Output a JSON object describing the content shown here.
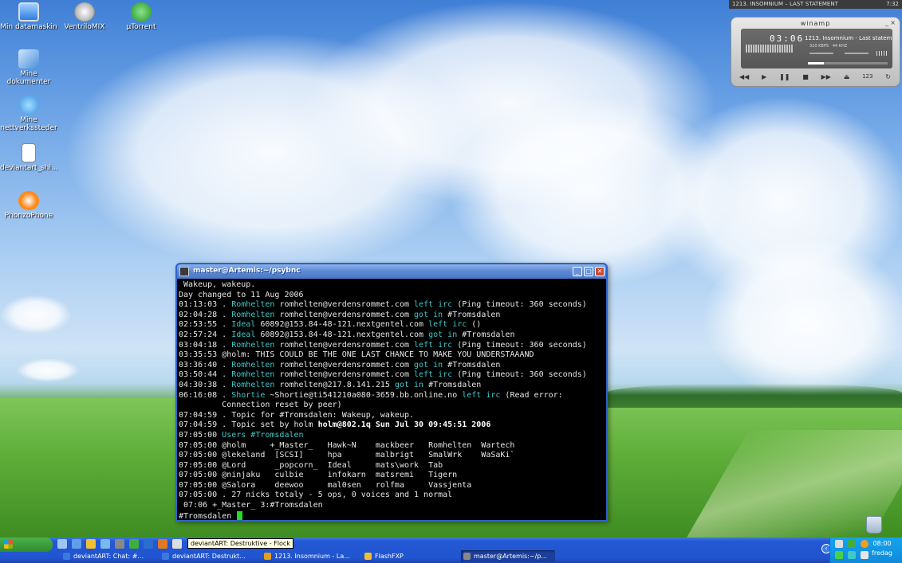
{
  "desktop": {
    "icons": [
      {
        "label": "Min datamaskin",
        "icon": "computer-icon",
        "color": "#2f7de0"
      },
      {
        "label": "VentriloMIX",
        "icon": "ventrilo-icon",
        "color": "#e6e6e6"
      },
      {
        "label": "µTorrent",
        "icon": "utorrent-icon",
        "color": "#3fae3f"
      },
      {
        "label": "Mine dokumenter",
        "icon": "documents-folder-icon",
        "color": "#4a90d9"
      },
      {
        "label": "Mine nettverkssteder",
        "icon": "network-places-icon",
        "color": "#3b8de0"
      },
      {
        "label": "deviantart_shi...",
        "icon": "text-file-icon",
        "color": "#ffffff"
      },
      {
        "label": "PhonzoPhone",
        "icon": "phone-app-icon",
        "color": "#ff8a1c"
      }
    ]
  },
  "winamp": {
    "topbar_title": "1213. INSOMNIUM – LAST STATEMENT",
    "topbar_time": "7:32",
    "title": "winamp",
    "time": "03:06",
    "song": "1213. Insomnium - Last statem",
    "kbps": "320",
    "kbps_unit": "KBPS",
    "khz": "44",
    "khz_unit": "KHZ",
    "track_number": "123"
  },
  "terminal": {
    "title": "master@Artemis:~/psybnc",
    "lines": [
      [
        {
          "t": " Wakeup, wakeup."
        }
      ],
      [
        {
          "t": "Day changed to 11 Aug 2006"
        }
      ],
      [
        {
          "t": "01:13:03 . "
        },
        {
          "t": "Romhelten",
          "c": "c"
        },
        {
          "t": " romhelten@verdensrommet.com "
        },
        {
          "t": "left irc",
          "c": "c"
        },
        {
          "t": " (Ping timeout: 360 seconds)"
        }
      ],
      [
        {
          "t": "02:04:28 . "
        },
        {
          "t": "Romhelten",
          "c": "c"
        },
        {
          "t": " romhelten@verdensrommet.com "
        },
        {
          "t": "got in",
          "c": "c"
        },
        {
          "t": " #Tromsdalen"
        }
      ],
      [
        {
          "t": "02:53:55 . "
        },
        {
          "t": "Ideal",
          "c": "c"
        },
        {
          "t": " 60892@153.84-48-121.nextgentel.com "
        },
        {
          "t": "left irc",
          "c": "c"
        },
        {
          "t": " ()"
        }
      ],
      [
        {
          "t": "02:57:24 . "
        },
        {
          "t": "Ideal",
          "c": "c"
        },
        {
          "t": " 60892@153.84-48-121.nextgentel.com "
        },
        {
          "t": "got in",
          "c": "c"
        },
        {
          "t": " #Tromsdalen"
        }
      ],
      [
        {
          "t": "03:04:18 . "
        },
        {
          "t": "Romhelten",
          "c": "c"
        },
        {
          "t": " romhelten@verdensrommet.com "
        },
        {
          "t": "left irc",
          "c": "c"
        },
        {
          "t": " (Ping timeout: 360 seconds)"
        }
      ],
      [
        {
          "t": "03:35:53 @holm: THIS COULD BE THE ONE LAST CHANCE TO MAKE YOU UNDERSTAAAND"
        }
      ],
      [
        {
          "t": "03:36:40 . "
        },
        {
          "t": "Romhelten",
          "c": "c"
        },
        {
          "t": " romhelten@verdensrommet.com "
        },
        {
          "t": "got in",
          "c": "c"
        },
        {
          "t": " #Tromsdalen"
        }
      ],
      [
        {
          "t": "03:50:44 . "
        },
        {
          "t": "Romhelten",
          "c": "c"
        },
        {
          "t": " romhelten@verdensrommet.com "
        },
        {
          "t": "left irc",
          "c": "c"
        },
        {
          "t": " (Ping timeout: 360 seconds)"
        }
      ],
      [
        {
          "t": "04:30:38 . "
        },
        {
          "t": "Romhelten",
          "c": "c"
        },
        {
          "t": " romhelten@217.8.141.215 "
        },
        {
          "t": "got in",
          "c": "c"
        },
        {
          "t": " #Tromsdalen"
        }
      ],
      [
        {
          "t": "06:16:08 . "
        },
        {
          "t": "Shortie",
          "c": "c"
        },
        {
          "t": " ~Shortie@ti541210a080-3659.bb.online.no "
        },
        {
          "t": "left irc",
          "c": "c"
        },
        {
          "t": " (Read error:"
        }
      ],
      [
        {
          "t": "         Connection reset by peer)"
        }
      ],
      [
        {
          "t": "07:04:59 . Topic for #Tromsdalen: Wakeup, wakeup."
        }
      ],
      [
        {
          "t": "07:04:59 . Topic set by holm "
        },
        {
          "t": "holm@802.1q Sun Jul 30 09:45:51 2006",
          "c": "b"
        }
      ],
      [
        {
          "t": "07:05:00 "
        },
        {
          "t": "Users #Tromsdalen",
          "c": "c"
        }
      ],
      [
        {
          "t": "07:05:00 @holm     +_Master_   Hawk~N    mackbeer   Romhelten  Wartech"
        }
      ],
      [
        {
          "t": "07:05:00 @lekeland  [SCSI]     hpa       malbrigt   SmalWrk    WaSaKi`"
        }
      ],
      [
        {
          "t": "07:05:00 @Lord      _popcorn_  Ideal     mats\\work  Tab"
        }
      ],
      [
        {
          "t": "07:05:00 @ninjaku   culbie     infokarn  matsremi   Tigern"
        }
      ],
      [
        {
          "t": "07:05:00 @Salora    deewoo     mal0sen   rolfma     Vassjenta"
        }
      ],
      [
        {
          "t": "07:05:00 . 27 nicks totaly - 5 ops, 0 voices and 1 normal"
        }
      ],
      [
        {
          "t": " 07:06 +_Master_ 3:#Tromsdalen"
        }
      ]
    ],
    "prompt": "#Tromsdalen "
  },
  "taskbar": {
    "tooltip": "deviantART: Destruktive - Flock",
    "tasks": [
      {
        "label": "deviantART: Chat: #...",
        "icon": "flock-browser-icon",
        "color": "#3a7ae0"
      },
      {
        "label": "deviantART: Destrukt...",
        "icon": "flock-browser-icon",
        "color": "#3a7ae0"
      },
      {
        "label": "1213. Insomnium - La...",
        "icon": "winamp-icon",
        "color": "#e0a020"
      },
      {
        "label": "FlashFXP",
        "icon": "flashfxp-icon",
        "color": "#f0c030"
      },
      {
        "label": "master@Artemis:~/p...",
        "icon": "putty-terminal-icon",
        "color": "#888888"
      }
    ],
    "clock_time": "08:00",
    "clock_day": "fredag"
  }
}
